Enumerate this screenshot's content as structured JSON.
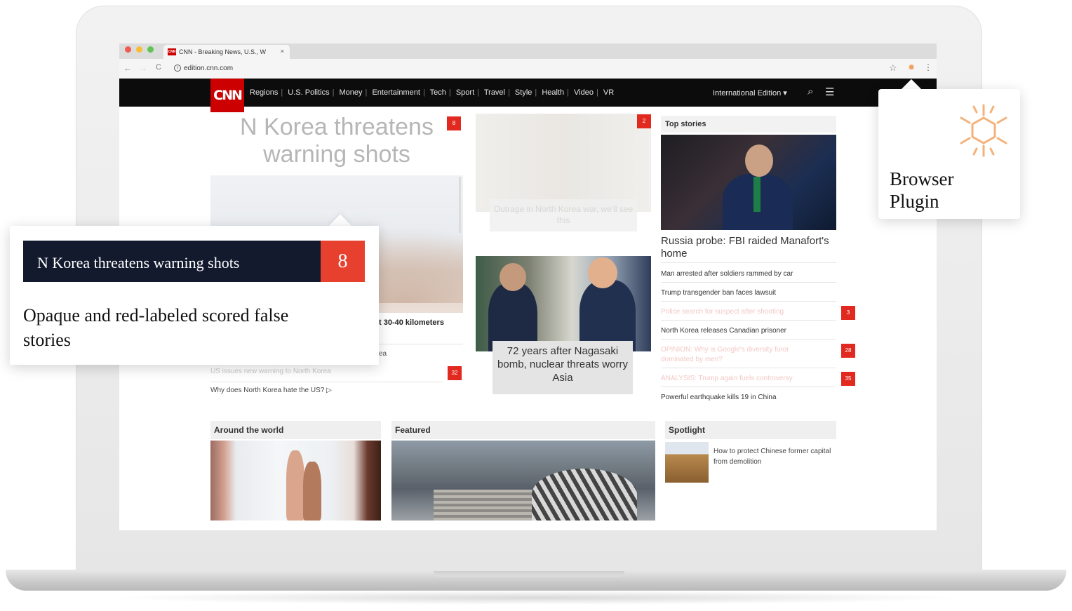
{
  "browser": {
    "tab_title": "CNN - Breaking News, U.S., W",
    "tab_favicon": "CNN",
    "tab_close": "×",
    "url": "edition.cnn.com",
    "back": "←",
    "forward": "→",
    "reload": "C"
  },
  "cnn": {
    "logo": "CNN",
    "nav": [
      "Regions",
      "U.S. Politics",
      "Money",
      "Entertainment",
      "Tech",
      "Sport",
      "Travel",
      "Style",
      "Health",
      "Video",
      "VR"
    ],
    "edition": "International Edition ▾"
  },
  "content": {
    "headline": "N Korea threatens warning shots",
    "headline_badge": "8",
    "soldiers_badge": "2",
    "kilometers": "t 30-40 kilometers",
    "lead_fragment": "ea",
    "faded_story": "US issues new warning to North Korea",
    "faded_story_badge": "32",
    "why_story": "Why does North Korea hate the US? ▷",
    "soldiers_caption": "Outrage in North Korea war, we'll see this",
    "meeting_caption": "72 years after Nagasaki bomb, nuclear threats worry Asia"
  },
  "top_stories": {
    "title": "Top stories",
    "lead": "Russia probe: FBI raided Manafort's home",
    "items": [
      {
        "text": "Man arrested after soldiers rammed by car",
        "faded": false,
        "badge": ""
      },
      {
        "text": "Trump transgender ban faces lawsuit",
        "faded": false,
        "badge": ""
      },
      {
        "text": "Police search for suspect after shooting",
        "faded": true,
        "badge": "3"
      },
      {
        "text": "North Korea releases Canadian prisoner",
        "faded": false,
        "badge": ""
      },
      {
        "text": "OPINION: Why is Google's diversity furor dominated by men?",
        "faded": true,
        "badge": "28"
      },
      {
        "text": "ANALYSIS: Trump again fuels controversy",
        "faded": true,
        "badge": "35"
      },
      {
        "text": "Powerful earthquake kills 19 in China",
        "faded": false,
        "badge": ""
      }
    ]
  },
  "sections": {
    "world": "Around the world",
    "featured": "Featured",
    "spotlight": "Spotlight",
    "spotlight_story": "How to protect Chinese former capital from demolition"
  },
  "callout": {
    "headline": "N Korea threatens warning shots",
    "score": "8",
    "description": "Opaque and red-labeled scored false stories"
  },
  "plugin": {
    "label": "Browser Plugin",
    "icon": "sun-icon",
    "color": "#f3b27a"
  },
  "colors": {
    "cnn_red": "#cc0000",
    "badge_red": "#e2291f",
    "callout_navy": "#131a2e",
    "score_red": "#e8402f"
  }
}
